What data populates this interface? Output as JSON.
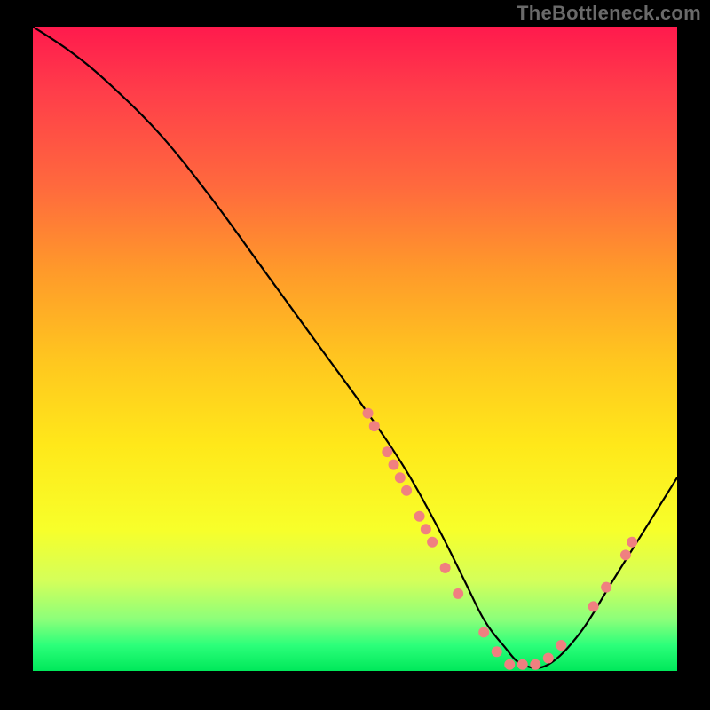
{
  "watermark": "TheBottleneck.com",
  "chart_data": {
    "type": "line",
    "title": "",
    "xlabel": "",
    "ylabel": "",
    "xlim": [
      0,
      100
    ],
    "ylim": [
      0,
      100
    ],
    "grid": false,
    "legend": false,
    "series": [
      {
        "name": "bottleneck-curve",
        "x": [
          0,
          6,
          12,
          20,
          28,
          36,
          44,
          52,
          58,
          63,
          67,
          70,
          73,
          76,
          80,
          85,
          90,
          95,
          100
        ],
        "y": [
          100,
          96,
          91,
          83,
          73,
          62,
          51,
          40,
          31,
          22,
          14,
          8,
          4,
          1,
          1,
          6,
          14,
          22,
          30
        ]
      }
    ],
    "marker_points": {
      "name": "highlight-dots",
      "points": [
        {
          "x": 52,
          "y": 40
        },
        {
          "x": 53,
          "y": 38
        },
        {
          "x": 55,
          "y": 34
        },
        {
          "x": 56,
          "y": 32
        },
        {
          "x": 57,
          "y": 30
        },
        {
          "x": 58,
          "y": 28
        },
        {
          "x": 60,
          "y": 24
        },
        {
          "x": 61,
          "y": 22
        },
        {
          "x": 62,
          "y": 20
        },
        {
          "x": 64,
          "y": 16
        },
        {
          "x": 66,
          "y": 12
        },
        {
          "x": 70,
          "y": 6
        },
        {
          "x": 72,
          "y": 3
        },
        {
          "x": 74,
          "y": 1
        },
        {
          "x": 76,
          "y": 1
        },
        {
          "x": 78,
          "y": 1
        },
        {
          "x": 80,
          "y": 2
        },
        {
          "x": 82,
          "y": 4
        },
        {
          "x": 87,
          "y": 10
        },
        {
          "x": 89,
          "y": 13
        },
        {
          "x": 92,
          "y": 18
        },
        {
          "x": 93,
          "y": 20
        }
      ],
      "radius": 6
    },
    "background_gradient": {
      "top": "#ff1a4d",
      "mid1": "#ff9a2a",
      "mid2": "#ffe81a",
      "bottom": "#00e85a"
    }
  }
}
